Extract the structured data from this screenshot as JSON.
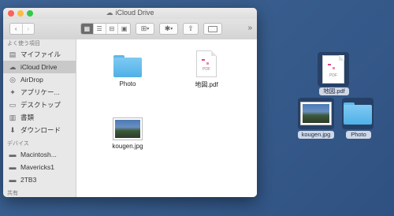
{
  "window": {
    "title": "iCloud Drive",
    "more_label": "»"
  },
  "toolbar": {
    "back_label": "‹",
    "forward_label": "›",
    "view_icon": "⊞",
    "action_icon": "✱",
    "share_icon": "⇧"
  },
  "sidebar": {
    "sections": [
      {
        "header": "よく使う項目",
        "items": [
          {
            "label": "マイファイル",
            "icon": "doc-icon"
          },
          {
            "label": "iCloud Drive",
            "icon": "cloud-icon",
            "selected": true
          },
          {
            "label": "AirDrop",
            "icon": "airdrop-icon"
          },
          {
            "label": "アプリケー...",
            "icon": "apps-icon"
          },
          {
            "label": "デスクトップ",
            "icon": "desktop-icon"
          },
          {
            "label": "書類",
            "icon": "documents-icon"
          },
          {
            "label": "ダウンロード",
            "icon": "download-icon"
          }
        ]
      },
      {
        "header": "デバイス",
        "items": [
          {
            "label": "Macintosh...",
            "icon": "disk-icon"
          },
          {
            "label": "Mavericks1",
            "icon": "disk-icon"
          },
          {
            "label": "2TB3",
            "icon": "disk-icon"
          }
        ]
      },
      {
        "header": "共有",
        "items": []
      }
    ]
  },
  "content": {
    "files": [
      {
        "name": "Photo",
        "type": "folder"
      },
      {
        "name": "地図.pdf",
        "type": "pdf"
      },
      {
        "name": "kougen.jpg",
        "type": "image"
      }
    ]
  },
  "desktop": {
    "items": [
      {
        "name": "地図.pdf",
        "type": "pdf"
      },
      {
        "name": "kougen.jpg",
        "type": "image"
      },
      {
        "name": "Photo",
        "type": "folder"
      }
    ]
  },
  "colors": {
    "desktop": "#3a5f91",
    "folder": "#5fb8ea",
    "selection": "#c9c9c9"
  }
}
